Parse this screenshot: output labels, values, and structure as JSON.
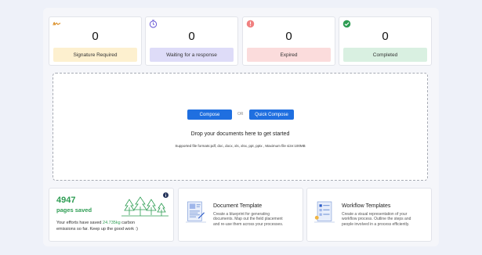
{
  "stats": [
    {
      "value": "0",
      "label": "Signature Required",
      "color": "#fdf0cf",
      "icon": "signature-icon"
    },
    {
      "value": "0",
      "label": "Waiting for a response",
      "color": "#dedcf8",
      "icon": "clock-icon"
    },
    {
      "value": "0",
      "label": "Expired",
      "color": "#fbdcdc",
      "icon": "exclamation-icon"
    },
    {
      "value": "0",
      "label": "Completed",
      "color": "#d9f0e1",
      "icon": "checkmark-icon"
    }
  ],
  "upload": {
    "compose_label": "Compose",
    "or_label": "OR",
    "quick_compose_label": "Quick Compose",
    "drop_title": "Drop your documents here to get started",
    "supported": "Supported file formats:pdf, doc, docx, xls, xlsx, ppt, pptx , Maximum file size:100MB"
  },
  "savings": {
    "count": "4947",
    "unit": "pages saved",
    "line1_prefix": "Your efforts have saved ",
    "amount": "24.735kg",
    "line1_suffix": " carbon",
    "line2": "emissions so far. Keep up the good work :)"
  },
  "document_template": {
    "title": "Document Template",
    "line1": "Create a blueprint for generating",
    "line2": "documents. Map out the field placement",
    "line3": "and re-use them across your processes."
  },
  "workflow_templates": {
    "title": "Workflow Templates",
    "line1": "Create a visual representation of your",
    "line2": "workflow process. Outline the steps and",
    "line3": "people involved in a process efficiently."
  },
  "colors": {
    "accent": "#1f6fe0",
    "green": "#2e9d53"
  }
}
